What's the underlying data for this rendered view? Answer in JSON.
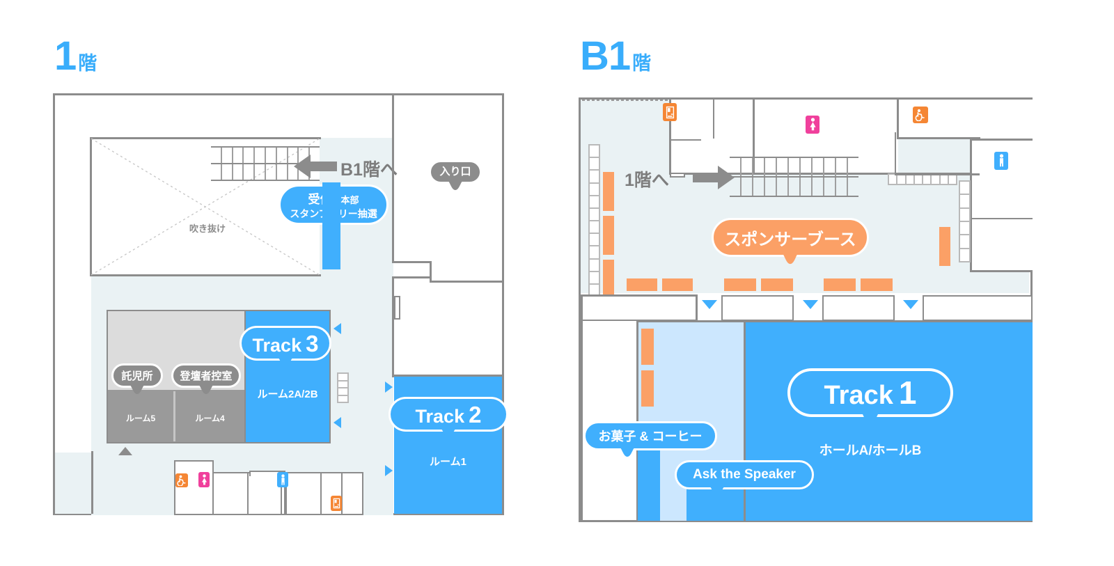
{
  "floor1": {
    "title_big": "1",
    "title_sub": "階",
    "void_label": "吹き抜け",
    "direction_to_b1": "B1階へ",
    "entrance_label": "入り口",
    "reception": {
      "line1": "受付",
      "line1b": "・本部",
      "line2": "スタンプラリー抽選"
    },
    "track3": {
      "name": "Track",
      "num": "3"
    },
    "track3_room": "ルーム2A/2B",
    "track2": {
      "name": "Track",
      "num": "2"
    },
    "track2_room": "ルーム1",
    "nursery": "託児所",
    "speaker_room": "登壇者控室",
    "room5": "ルーム5",
    "room4": "ルーム4",
    "icons": [
      {
        "name": "accessible-toilet-icon",
        "color": "#F58634"
      },
      {
        "name": "womens-toilet-icon",
        "color": "#F0409C"
      },
      {
        "name": "mens-toilet-icon",
        "color": "#40AFFD"
      },
      {
        "name": "vending-machine-icon",
        "color": "#F58634"
      }
    ]
  },
  "floorB1": {
    "title_big": "B1",
    "title_sub": "階",
    "direction_to_1f": "1階へ",
    "sponsor_booth": "スポンサーブース",
    "track1": {
      "name": "Track",
      "num": "1"
    },
    "track1_room": "ホールA/ホールB",
    "snack_coffee": "お菓子 & コーヒー",
    "ask_the_speaker": "Ask the Speaker",
    "icons": [
      {
        "name": "vending-machine-icon",
        "color": "#F58634"
      },
      {
        "name": "womens-toilet-icon",
        "color": "#F0409C"
      },
      {
        "name": "accessible-toilet-icon",
        "color": "#F58634"
      },
      {
        "name": "mens-toilet-icon",
        "color": "#40AFFD"
      }
    ]
  },
  "colors": {
    "accent_blue": "#40AFFD",
    "accent_orange": "#FBA066",
    "pale": "#EAF2F4",
    "light_blue": "#CCE7FE",
    "wall_gray": "#8C8C8C",
    "room_gray": "#9A9A9A",
    "room_light_gray": "#DCDCDC",
    "pink": "#F0409C"
  }
}
